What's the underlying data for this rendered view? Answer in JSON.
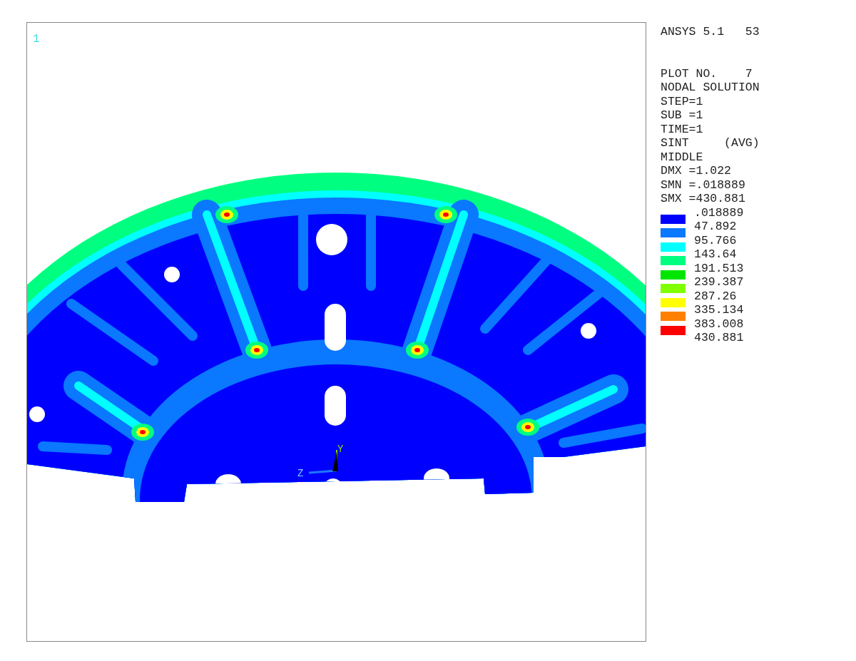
{
  "plot": {
    "window_number": "1",
    "axis_labels": [
      "Y",
      "Z"
    ]
  },
  "legend": {
    "header": "ANSYS 5.1   53",
    "info_lines": [
      "PLOT NO.    7",
      "NODAL SOLUTION",
      "STEP=1",
      "SUB =1",
      "TIME=1",
      "SINT     (AVG)",
      "MIDDLE",
      "DMX =1.022",
      "SMN =.018889",
      "SMX =430.881"
    ],
    "values": [
      ".018889",
      "47.892",
      "95.766",
      "143.64",
      "191.513",
      "239.387",
      "287.26",
      "335.134",
      "383.008",
      "430.881"
    ],
    "bands": [
      {
        "color": "#0000ff"
      },
      {
        "color": "#0a78ff"
      },
      {
        "color": "#00ffff"
      },
      {
        "color": "#00ff80"
      },
      {
        "color": "#00e600"
      },
      {
        "color": "#80ff00"
      },
      {
        "color": "#ffff00"
      },
      {
        "color": "#ff8000"
      },
      {
        "color": "#ff0000"
      }
    ]
  }
}
